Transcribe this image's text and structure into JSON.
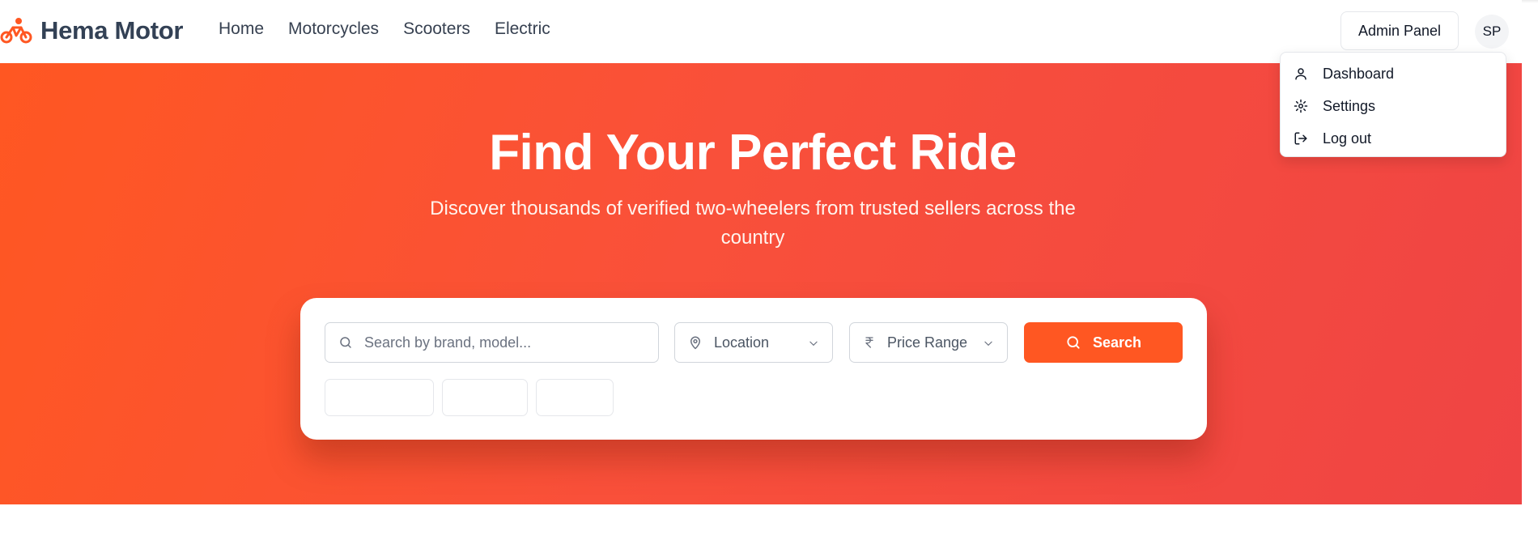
{
  "header": {
    "brand_name": "Hema Motor",
    "nav": [
      {
        "label": "Home"
      },
      {
        "label": "Motorcycles"
      },
      {
        "label": "Scooters"
      },
      {
        "label": "Electric"
      }
    ],
    "admin_button": "Admin Panel",
    "avatar_initials": "SP"
  },
  "user_menu": {
    "items": [
      {
        "label": "Dashboard",
        "icon": "user-icon"
      },
      {
        "label": "Settings",
        "icon": "gear-icon"
      },
      {
        "label": "Log out",
        "icon": "logout-icon"
      }
    ]
  },
  "hero": {
    "title": "Find Your Perfect Ride",
    "subtitle": "Discover thousands of verified two-wheelers from trusted sellers across the country"
  },
  "search": {
    "placeholder": "Search by brand, model...",
    "location_value": "Location",
    "price_value": "Price Range",
    "button_label": "Search"
  },
  "colors": {
    "accent": "#ff5722",
    "hero_gradient_start": "#ff5722",
    "hero_gradient_end": "#ef4444"
  }
}
